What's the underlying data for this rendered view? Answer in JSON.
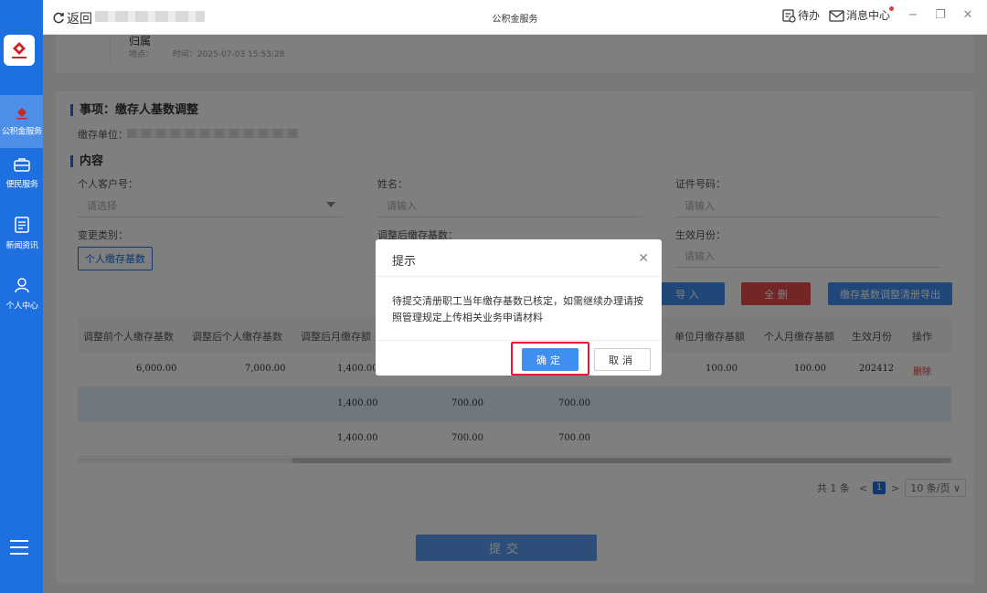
{
  "window": {
    "back_label": "返回",
    "title": "公积金服务",
    "todo_label": "待办",
    "messages_label": "消息中心",
    "minimize": "−",
    "restore": "❐",
    "close": "✕"
  },
  "sidebar": {
    "items": [
      {
        "label": "公积金服务",
        "icon": "logo-icon"
      },
      {
        "label": "便民服务",
        "icon": "briefcase-icon"
      },
      {
        "label": "新闻资讯",
        "icon": "news-icon"
      },
      {
        "label": "个人中心",
        "icon": "user-icon"
      }
    ]
  },
  "record": {
    "title": "归属",
    "location_label": "地点：",
    "time": "时间：2025-07-03 15:53:28"
  },
  "form": {
    "item_title": "事项：缴存人基数调整",
    "unit_label": "缴存单位：",
    "content_title": "内容",
    "customer_no_label": "个人客户号：",
    "customer_no_placeholder": "请选择",
    "name_label": "姓名：",
    "name_placeholder": "请输入",
    "id_no_label": "证件号码：",
    "id_no_placeholder": "请输入",
    "change_type_label": "变更类别：",
    "change_type_tag": "个人缴存基数",
    "adjusted_base_label": "调整后缴存基数：",
    "effective_month_label": "生效月份：",
    "effective_month_placeholder": "请输入"
  },
  "actions": {
    "import": "导 入",
    "delete_all": "全 删",
    "export": "缴存基数调整清册导出"
  },
  "table": {
    "headers": [
      "调整前个人缴存基数",
      "调整后个人缴存基数",
      "调整后月缴存额",
      "单位月缴存基额",
      "个人月缴存基额",
      "生效月份",
      "操作"
    ],
    "rows": [
      {
        "before": "6,000.00",
        "after": "7,000.00",
        "monthly": "1,400.00",
        "unit": "100.00",
        "personal": "100.00",
        "month": "202412",
        "op": "删除"
      },
      {
        "monthly": "1,400.00",
        "c4": "700.00",
        "c5": "700.00"
      },
      {
        "monthly": "1,400.00",
        "c4": "700.00",
        "c5": "700.00"
      }
    ]
  },
  "pager": {
    "total": "共 1 条",
    "prev": "<",
    "page": "1",
    "next": ">",
    "size": "10 条/页 ∨"
  },
  "submit_label": "提交",
  "dialog": {
    "title": "提示",
    "message": "待提交清册职工当年缴存基数已核定，如需继续办理请按照管理规定上传相关业务申请材料",
    "ok": "确定",
    "cancel": "取消"
  },
  "colors": {
    "primary": "#1e6fe0",
    "highlight": "#e5183a",
    "danger": "#e53935"
  }
}
